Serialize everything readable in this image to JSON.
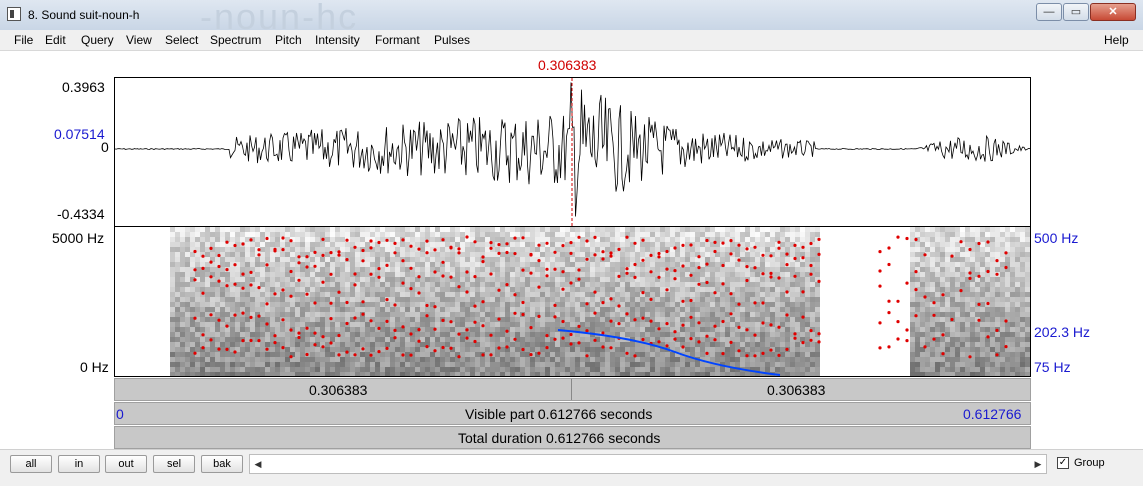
{
  "window": {
    "title": "8. Sound suit-noun-h",
    "background_title_ghost": "-noun-hc",
    "controls": {
      "minimize": "—",
      "maximize": "▭",
      "close": "✕"
    }
  },
  "menu": {
    "items": [
      "File",
      "Edit",
      "Query",
      "View",
      "Select",
      "Spectrum",
      "Pitch",
      "Intensity",
      "Formant",
      "Pulses"
    ],
    "help": "Help"
  },
  "cursor": {
    "time_label": "0.306383",
    "color": "#d00000"
  },
  "waveform": {
    "y_max": "0.3963",
    "y_cursor": "0.07514",
    "y_zero": "0",
    "y_min": "-0.4334"
  },
  "spectrogram": {
    "y_top": "5000 Hz",
    "y_bottom": "0 Hz",
    "pitch_top": "500 Hz",
    "pitch_cursor": "202.3 Hz",
    "pitch_bottom": "75 Hz",
    "formant_color": "#e00000",
    "pitch_color": "#0044ff"
  },
  "time_bar": {
    "left": "0.306383",
    "right": "0.306383"
  },
  "visible_bar": {
    "start": "0",
    "text": "Visible part 0.612766 seconds",
    "end": "0.612766"
  },
  "total_bar": {
    "text": "Total duration 0.612766 seconds"
  },
  "bottom": {
    "buttons": [
      "all",
      "in",
      "out",
      "sel",
      "bak"
    ],
    "scroll_left": "◀",
    "scroll_right": "▶",
    "group_checked": "✓",
    "group_label": "Group"
  }
}
